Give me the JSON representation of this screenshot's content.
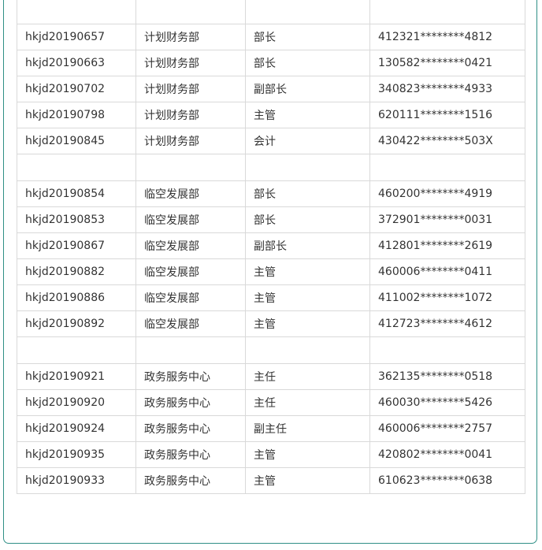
{
  "table": {
    "groups": [
      {
        "rows": [
          {
            "id": "hkjd20190657",
            "dept": "计划财务部",
            "title": "部长",
            "idno": "412321********4812"
          },
          {
            "id": "hkjd20190663",
            "dept": "计划财务部",
            "title": "部长",
            "idno": "130582********0421"
          },
          {
            "id": "hkjd20190702",
            "dept": "计划财务部",
            "title": "副部长",
            "idno": "340823********4933"
          },
          {
            "id": "hkjd20190798",
            "dept": "计划财务部",
            "title": "主管",
            "idno": "620111********1516"
          },
          {
            "id": "hkjd20190845",
            "dept": "计划财务部",
            "title": "会计",
            "idno": "430422********503X"
          }
        ]
      },
      {
        "rows": [
          {
            "id": "hkjd20190854",
            "dept": "临空发展部",
            "title": "部长",
            "idno": "460200********4919"
          },
          {
            "id": "hkjd20190853",
            "dept": "临空发展部",
            "title": "部长",
            "idno": "372901********0031"
          },
          {
            "id": "hkjd20190867",
            "dept": "临空发展部",
            "title": "副部长",
            "idno": "412801********2619"
          },
          {
            "id": "hkjd20190882",
            "dept": "临空发展部",
            "title": "主管",
            "idno": "460006********0411"
          },
          {
            "id": "hkjd20190886",
            "dept": "临空发展部",
            "title": "主管",
            "idno": "411002********1072"
          },
          {
            "id": "hkjd20190892",
            "dept": "临空发展部",
            "title": "主管",
            "idno": "412723********4612"
          }
        ]
      },
      {
        "rows": [
          {
            "id": "hkjd20190921",
            "dept": "政务服务中心",
            "title": "主任",
            "idno": "362135********0518"
          },
          {
            "id": "hkjd20190920",
            "dept": "政务服务中心",
            "title": "主任",
            "idno": "460030********5426"
          },
          {
            "id": "hkjd20190924",
            "dept": "政务服务中心",
            "title": "副主任",
            "idno": "460006********2757"
          },
          {
            "id": "hkjd20190935",
            "dept": "政务服务中心",
            "title": "主管",
            "idno": "420802********0041"
          },
          {
            "id": "hkjd20190933",
            "dept": "政务服务中心",
            "title": "主管",
            "idno": "610623********0638"
          }
        ]
      }
    ]
  },
  "colors": {
    "frame_border": "#2f8f86",
    "cell_border": "#d9d9d9",
    "text": "#333333"
  }
}
